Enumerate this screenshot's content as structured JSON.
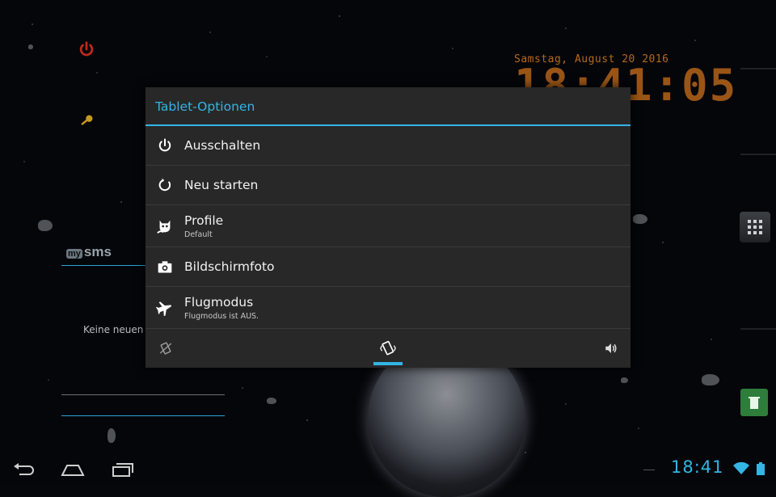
{
  "clock_widget": {
    "date": "Samstag,  August 20 2016",
    "time": "18:41:05"
  },
  "home_icons": {
    "power_icon": "power-icon",
    "key_icon": "key-icon"
  },
  "sms_widget": {
    "logo_my": "my",
    "logo_sms": "sms",
    "empty_text": "Keine neuen"
  },
  "dialog": {
    "title": "Tablet-Optionen",
    "options": [
      {
        "label": "Ausschalten",
        "sub": "",
        "icon": "power-icon"
      },
      {
        "label": "Neu starten",
        "sub": "",
        "icon": "restart-icon"
      },
      {
        "label": "Profile",
        "sub": "Default",
        "icon": "profile-icon"
      },
      {
        "label": "Bildschirmfoto",
        "sub": "",
        "icon": "camera-icon"
      },
      {
        "label": "Flugmodus",
        "sub": "Flugmodus ist AUS.",
        "icon": "airplane-icon"
      }
    ],
    "sound_modes": {
      "selected": "vibrate",
      "modes": [
        "silent",
        "vibrate",
        "sound"
      ]
    }
  },
  "system_bar": {
    "time": "18:41",
    "accent": "#33b5e5"
  },
  "colors": {
    "accent": "#33b5e5",
    "dialog_bg": "#282828",
    "clock": "#b5691d"
  }
}
